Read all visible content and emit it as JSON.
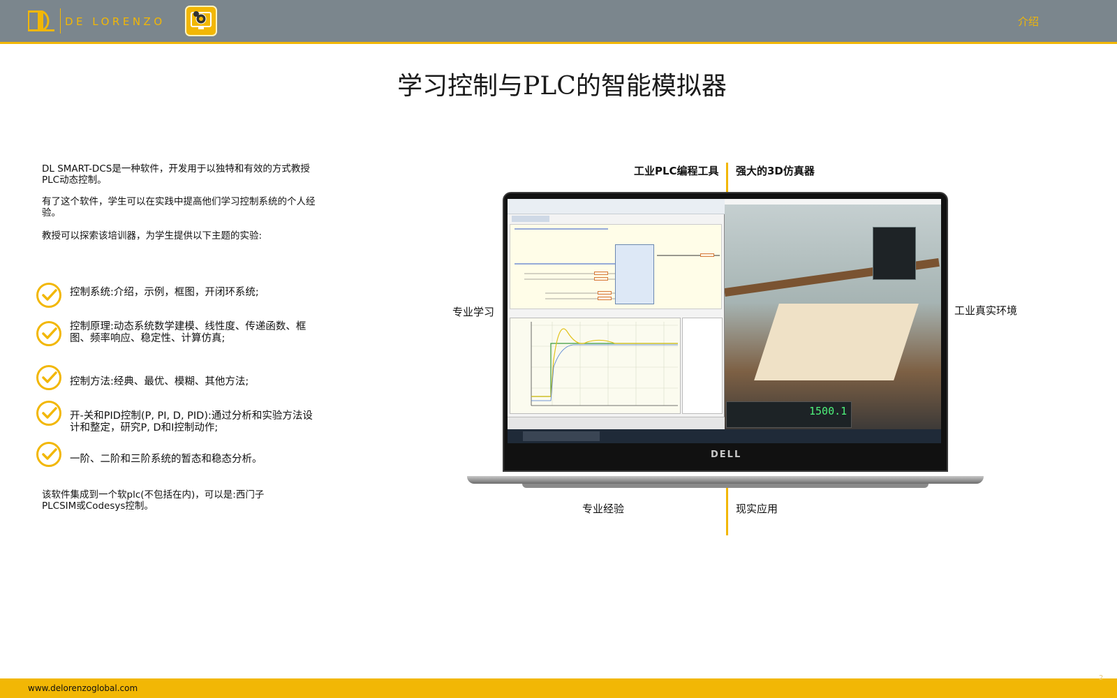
{
  "header": {
    "brand": "DE LORENZO",
    "nav_label": "介绍"
  },
  "title": "学习控制与PLC的智能模拟器",
  "intro": [
    "DL SMART-DCS是一种软件，开发用于以独特和有效的方式教授PLC动态控制。",
    "有了这个软件，学生可以在实践中提高他们学习控制系统的个人经验。",
    "教授可以探索该培训器，为学生提供以下主题的实验:"
  ],
  "topics": [
    "控制系统:介绍，示例，框图，开闭环系统;",
    "控制原理:动态系统数学建模、线性度、传递函数、框图、频率响应、稳定性、计算仿真;",
    "控制方法:经典、最优、模糊、其他方法;",
    "开-关和PID控制(P, PI, D, PID):通过分析和实验方法设计和整定，研究P, D和I控制动作;",
    "一阶、二阶和三阶系统的暂态和稳态分析。"
  ],
  "footer_note": "该软件集成到一个软plc(不包括在内)，可以是:西门子PLCSIM或Codesys控制。",
  "callouts": {
    "top_left": "工业PLC编程工具",
    "top_right": "强大的3D仿真器",
    "mid_left": "专业学习",
    "mid_right": "工业真实环境",
    "bottom_left": "专业经验",
    "bottom_right": "现实应用"
  },
  "laptop": {
    "brand": "DELL",
    "readout": "1500.1"
  },
  "footer": {
    "url": "www.delorenzoglobal.com",
    "page": "2"
  },
  "colors": {
    "accent": "#f2b705",
    "header_gray": "#7b868d"
  }
}
